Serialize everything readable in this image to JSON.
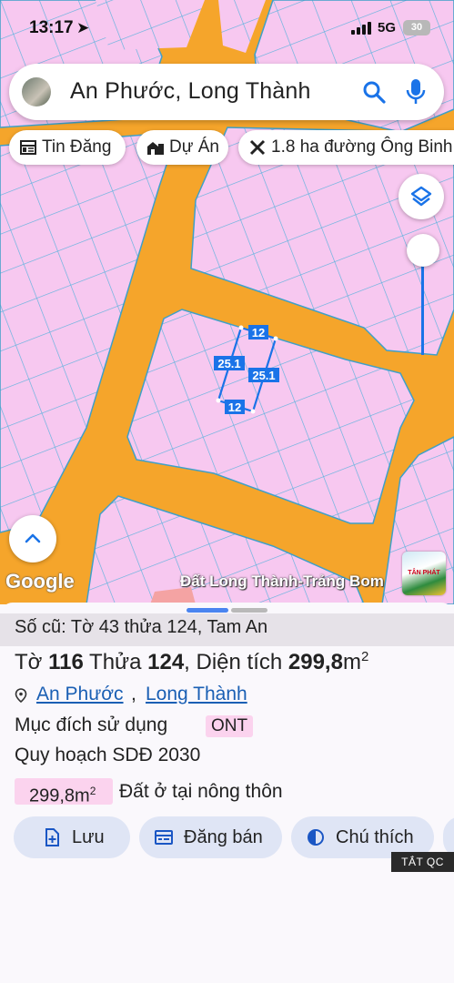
{
  "status_bar": {
    "time": "13:17",
    "network": "5G",
    "battery": "30"
  },
  "search": {
    "query": "An Phước, Long Thành"
  },
  "chips": [
    {
      "label": "Tin Đăng",
      "icon": "newspaper-icon"
    },
    {
      "label": "Dự Án",
      "icon": "buildings-icon"
    },
    {
      "label": "1.8 ha đường Ông Binh",
      "icon": "ruler-cross-icon"
    }
  ],
  "map": {
    "plot_labels": {
      "top": "12",
      "bottom": "12",
      "left": "25.1",
      "right": "25.1"
    },
    "google_logo": "Google",
    "watermark": "Đất Long Thành-Trảng Bom",
    "thumbnail_text": "TÂN PHÁT"
  },
  "sheet": {
    "old_info": "Số cũ: Tờ 43 thửa 124, Tam An",
    "title_pre": "Tờ ",
    "sheet_no": "116",
    "title_mid": " Thửa ",
    "parcel_no": "124",
    "title_post": ", Diện tích ",
    "area_value": "299,8",
    "area_unit": "m",
    "area_sup": "2",
    "location_ward": "An Phước",
    "location_sep": ",",
    "location_district": "Long Thành",
    "purpose_label": "Mục đích sử dụng",
    "purpose_code": "ONT",
    "plan_label": "Quy hoạch SDĐ 2030",
    "area_badge_value": "299,8m",
    "area_badge_sup": "2",
    "land_type": "Đất ở tại nông thôn"
  },
  "actions": [
    {
      "label": "Lưu",
      "icon": "add-document-icon"
    },
    {
      "label": "Đăng bán",
      "icon": "listing-icon"
    },
    {
      "label": "Chú thích",
      "icon": "contrast-icon"
    }
  ],
  "ad_close": "TẮT QC",
  "colors": {
    "road": "#f5a52b",
    "parcel": "#f7c8f0",
    "line": "#5db3dd",
    "accent": "#1a73e8",
    "chip_bg": "#dfe5f5"
  }
}
